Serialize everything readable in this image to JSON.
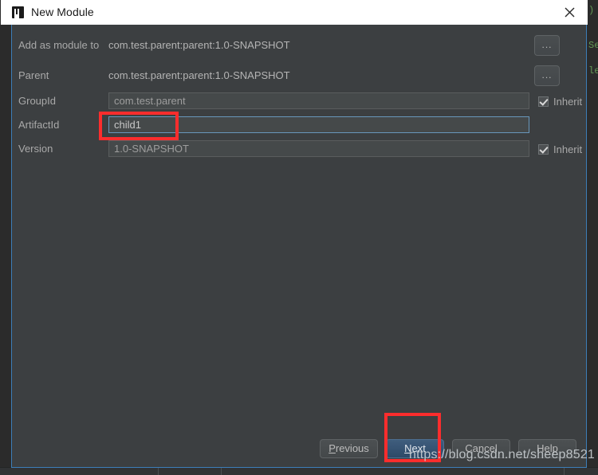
{
  "window": {
    "title": "New Module",
    "app_icon": "intellij-idea-logo-icon",
    "close_icon": "close-icon"
  },
  "form": {
    "add_as_module": {
      "label": "Add as module to",
      "value": "com.test.parent:parent:1.0-SNAPSHOT",
      "browse_label": "..."
    },
    "parent": {
      "label": "Parent",
      "value": "com.test.parent:parent:1.0-SNAPSHOT",
      "browse_label": "..."
    },
    "group_id": {
      "label": "GroupId",
      "value": "com.test.parent",
      "inherit_label": "Inherit",
      "inherit_checked": true
    },
    "artifact_id": {
      "label": "ArtifactId",
      "value": "child1",
      "focused": true
    },
    "version": {
      "label": "Version",
      "value": "1.0-SNAPSHOT",
      "inherit_label": "Inherit",
      "inherit_checked": true
    }
  },
  "buttons": {
    "previous": {
      "label": "Previous",
      "mnemonic": "P"
    },
    "next": {
      "label": "Next",
      "mnemonic": "N",
      "is_default": true
    },
    "cancel": {
      "label": "Cancel"
    },
    "help": {
      "label": "Help"
    }
  },
  "annotations": {
    "color": "#fc2d2d",
    "watermark": "https://blog.csdn.net/sheep8521"
  },
  "background_editor": {
    "fragments": [
      ")",
      "Se",
      "le"
    ],
    "code_color": "#629755"
  }
}
